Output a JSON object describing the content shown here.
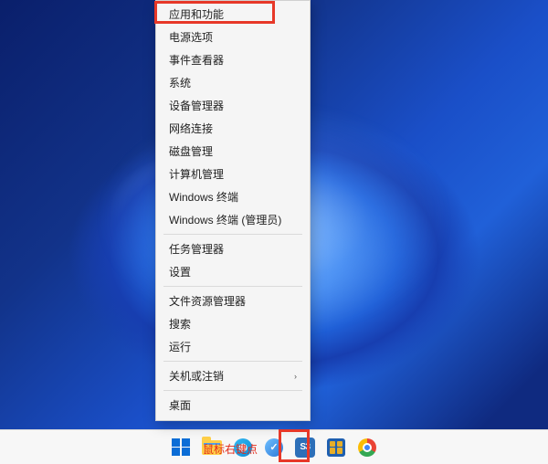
{
  "annotation": "鼠标右键点",
  "menu": {
    "items": [
      {
        "label": "应用和功能"
      },
      {
        "label": "电源选项"
      },
      {
        "label": "事件查看器"
      },
      {
        "label": "系统"
      },
      {
        "label": "设备管理器"
      },
      {
        "label": "网络连接"
      },
      {
        "label": "磁盘管理"
      },
      {
        "label": "计算机管理"
      },
      {
        "label": "Windows 终端"
      },
      {
        "label": "Windows 终端 (管理员)"
      }
    ],
    "group2": [
      {
        "label": "任务管理器"
      },
      {
        "label": "设置"
      }
    ],
    "group3": [
      {
        "label": "文件资源管理器"
      },
      {
        "label": "搜索"
      },
      {
        "label": "运行"
      }
    ],
    "group4": [
      {
        "label": "关机或注销",
        "chevron": "›"
      }
    ],
    "group5": [
      {
        "label": "桌面"
      }
    ]
  },
  "taskbar": {
    "s3_label": "S3"
  }
}
